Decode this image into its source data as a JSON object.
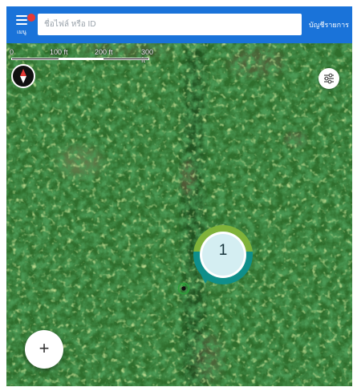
{
  "header": {
    "menu_label": "เมนู",
    "search_placeholder": "ชื่อไฟล์ หรือ ID",
    "account_label": "บัญชีรายการ"
  },
  "map": {
    "scale_labels": [
      "0",
      "100 ft",
      "200 ft",
      "300 ft"
    ],
    "cluster_count": "1",
    "icons": [
      "compass-icon",
      "filter-sliders-icon",
      "location-marker-icon",
      "plus-icon"
    ],
    "colors": {
      "top_bar": "#1a73d9",
      "cluster_ring": "#7fb23a",
      "cluster_ring_lower": "#0f8f8a",
      "cluster_fill": "#d4eef2",
      "marker": "#2e9e3a"
    }
  },
  "actions": {
    "add_symbol": "+"
  }
}
